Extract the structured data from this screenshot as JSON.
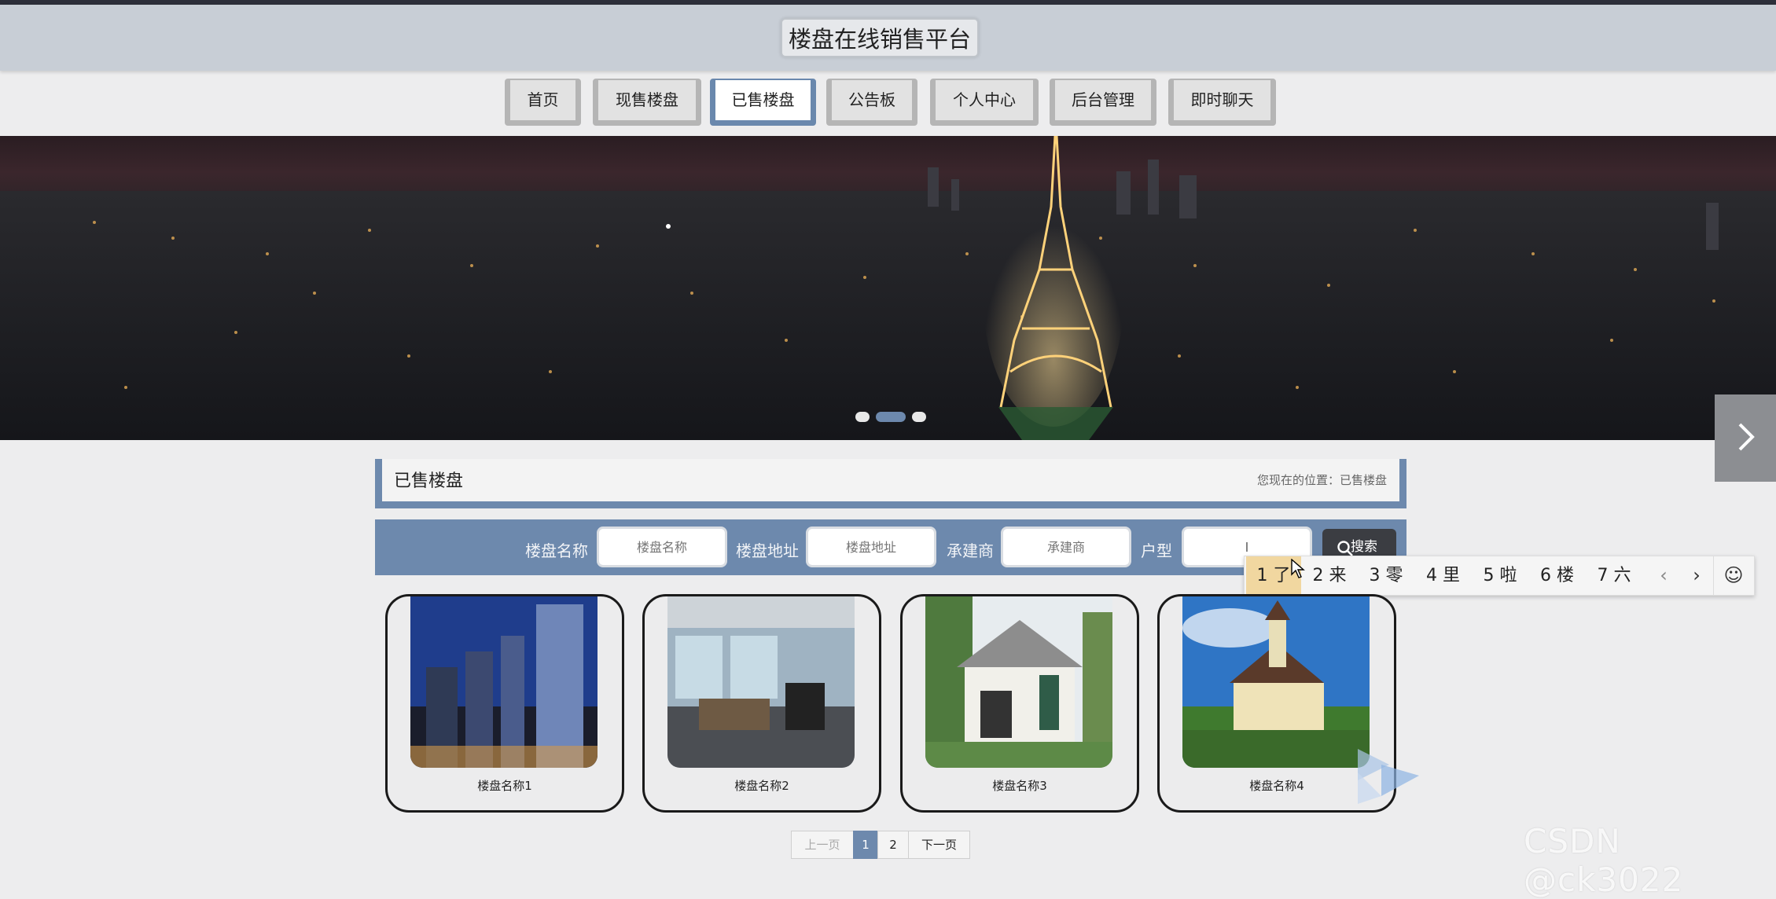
{
  "site": {
    "title": "楼盘在线销售平台"
  },
  "nav": {
    "items": [
      {
        "label": "首页"
      },
      {
        "label": "现售楼盘"
      },
      {
        "label": "已售楼盘"
      },
      {
        "label": "公告板"
      },
      {
        "label": "个人中心"
      },
      {
        "label": "后台管理"
      },
      {
        "label": "即时聊天"
      }
    ],
    "active": "已售楼盘"
  },
  "banner": {
    "next_icon": "chevron-right-icon",
    "dots": 3,
    "active_dot": 2
  },
  "section": {
    "title": "已售楼盘",
    "breadcrumb": "您现在的位置：已售楼盘"
  },
  "search": {
    "fields": [
      {
        "label": "楼盘名称",
        "placeholder": "楼盘名称",
        "value": ""
      },
      {
        "label": "楼盘地址",
        "placeholder": "楼盘地址",
        "value": ""
      },
      {
        "label": "承建商",
        "placeholder": "承建商",
        "value": ""
      },
      {
        "label": "户型",
        "placeholder": "",
        "value": "l"
      }
    ],
    "button_label": "搜索",
    "button_icon": "search-icon"
  },
  "ime": {
    "candidates": [
      "1 了",
      "2 来",
      "3 零",
      "4 里",
      "5 啦",
      "6 楼",
      "7 六"
    ],
    "selected": 0,
    "controls": [
      "‹",
      "›",
      "☺"
    ]
  },
  "listings": [
    {
      "name": "楼盘名称1"
    },
    {
      "name": "楼盘名称2"
    },
    {
      "name": "楼盘名称3"
    },
    {
      "name": "楼盘名称4"
    }
  ],
  "pagination": {
    "prev_label": "上一页",
    "pages": [
      "1",
      "2"
    ],
    "current": "1",
    "next_label": "下一页"
  },
  "watermark": "CSDN @ck3022",
  "colors": {
    "accent": "#6d89ad",
    "header_bg": "#c8ced6",
    "ime_selected": "#f1d7a0"
  }
}
